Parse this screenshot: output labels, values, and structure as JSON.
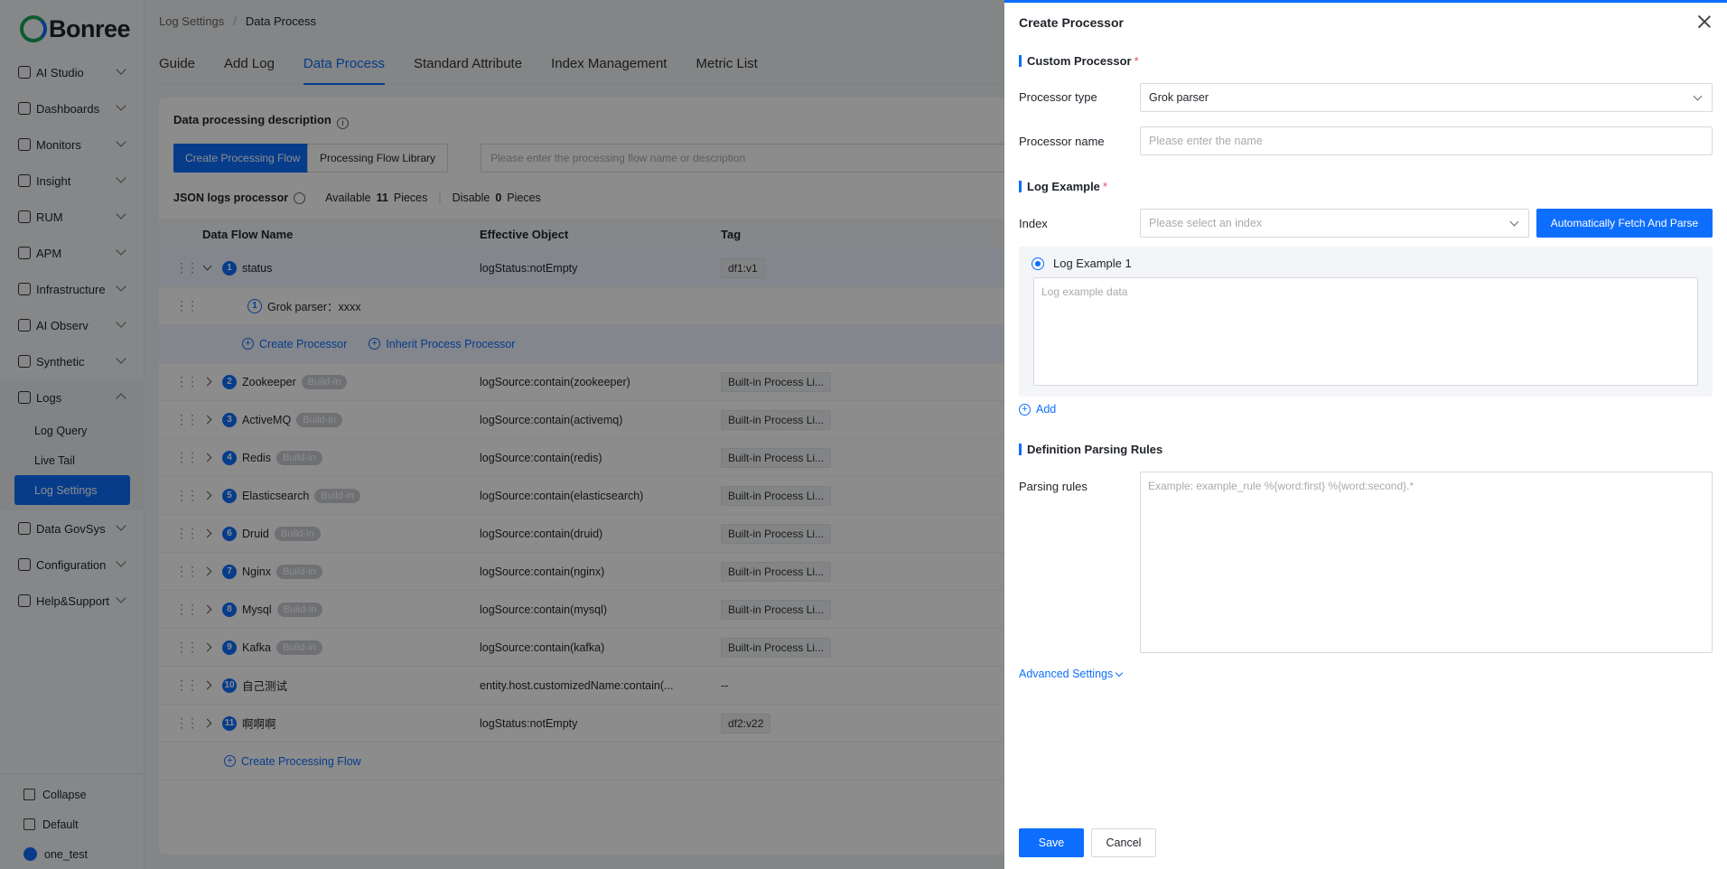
{
  "sidebar": {
    "logo": "Bonree",
    "items": [
      {
        "label": "AI Studio"
      },
      {
        "label": "Dashboards"
      },
      {
        "label": "Monitors"
      },
      {
        "label": "Insight"
      },
      {
        "label": "RUM"
      },
      {
        "label": "APM"
      },
      {
        "label": "Infrastructure"
      },
      {
        "label": "AI Observ"
      },
      {
        "label": "Synthetic"
      },
      {
        "label": "Logs"
      },
      {
        "label": "Data GovSys"
      },
      {
        "label": "Configuration"
      },
      {
        "label": "Help&Support"
      }
    ],
    "logs_sub": [
      {
        "label": "Log Query"
      },
      {
        "label": "Live Tail"
      },
      {
        "label": "Log Settings"
      }
    ],
    "footer": {
      "collapse": "Collapse",
      "workspace": "Default",
      "user": "one_test"
    }
  },
  "breadcrumb": {
    "parent": "Log Settings",
    "current": "Data Process"
  },
  "tabs": [
    {
      "label": "Guide"
    },
    {
      "label": "Add Log"
    },
    {
      "label": "Data Process"
    },
    {
      "label": "Standard Attribute"
    },
    {
      "label": "Index Management"
    },
    {
      "label": "Metric List"
    }
  ],
  "panel": {
    "title": "Data processing description",
    "create_flow_btn": "Create Processing Flow",
    "library_btn": "Processing Flow Library",
    "search_placeholder": "Please enter the processing flow name or description",
    "stats": {
      "name": "JSON logs processor",
      "available_label": "Available",
      "available": "11",
      "pieces1": "Pieces",
      "disable_label": "Disable",
      "disabled": "0",
      "pieces2": "Pieces"
    }
  },
  "table": {
    "headers": {
      "name": "Data Flow Name",
      "object": "Effective Object",
      "tag": "Tag"
    },
    "first_row": {
      "num": "1",
      "name": "status",
      "object": "logStatus:notEmpty",
      "tag": "df1:v1"
    },
    "child": {
      "num": "1",
      "name": "Grok parser：xxxx"
    },
    "child_actions": {
      "create": "Create Processor",
      "inherit": "Inherit Process Processor"
    },
    "rows": [
      {
        "num": "2",
        "name": "Zookeeper",
        "badge": "Build-in",
        "object": "logSource:contain(zookeeper)",
        "tag": "Built-in Process Li..."
      },
      {
        "num": "3",
        "name": "ActiveMQ",
        "badge": "Build-in",
        "object": "logSource:contain(activemq)",
        "tag": "Built-in Process Li..."
      },
      {
        "num": "4",
        "name": "Redis",
        "badge": "Build-in",
        "object": "logSource:contain(redis)",
        "tag": "Built-in Process Li..."
      },
      {
        "num": "5",
        "name": "Elasticsearch",
        "badge": "Build-in",
        "object": "logSource:contain(elasticsearch)",
        "tag": "Built-in Process Li..."
      },
      {
        "num": "6",
        "name": "Druid",
        "badge": "Build-in",
        "object": "logSource:contain(druid)",
        "tag": "Built-in Process Li..."
      },
      {
        "num": "7",
        "name": "Nginx",
        "badge": "Build-in",
        "object": "logSource:contain(nginx)",
        "tag": "Built-in Process Li..."
      },
      {
        "num": "8",
        "name": "Mysql",
        "badge": "Build-in",
        "object": "logSource:contain(mysql)",
        "tag": "Built-in Process Li..."
      },
      {
        "num": "9",
        "name": "Kafka",
        "badge": "Build-in",
        "object": "logSource:contain(kafka)",
        "tag": "Built-in Process Li..."
      },
      {
        "num": "10",
        "name": "自己测试",
        "badge": "",
        "object": "entity.host.customizedName:contain(...",
        "tag": "--"
      },
      {
        "num": "11",
        "name": "啊啊啊",
        "badge": "",
        "object": "logStatus:notEmpty",
        "tag": "df2:v22"
      }
    ],
    "footer_link": "Create Processing Flow"
  },
  "drawer": {
    "title": "Create Processor",
    "custom_section": "Custom Processor",
    "type_label": "Processor type",
    "type_value": "Grok parser",
    "name_label": "Processor name",
    "name_placeholder": "Please enter the name",
    "example_section": "Log Example",
    "index_label": "Index",
    "index_placeholder": "Please select an index",
    "fetch_btn": "Automatically Fetch And Parse",
    "example_radio": "Log Example 1",
    "example_placeholder": "Log example data",
    "add_link": "Add",
    "rules_section": "Definition Parsing Rules",
    "rules_label": "Parsing rules",
    "rules_placeholder": "Example: example_rule %{word:first} %{word:second}.*",
    "advanced": "Advanced Settings",
    "save": "Save",
    "cancel": "Cancel"
  },
  "colors": {
    "primary": "#0d6efd",
    "required": "#e34d59",
    "mask": "rgba(0,0,0,0.45)"
  }
}
